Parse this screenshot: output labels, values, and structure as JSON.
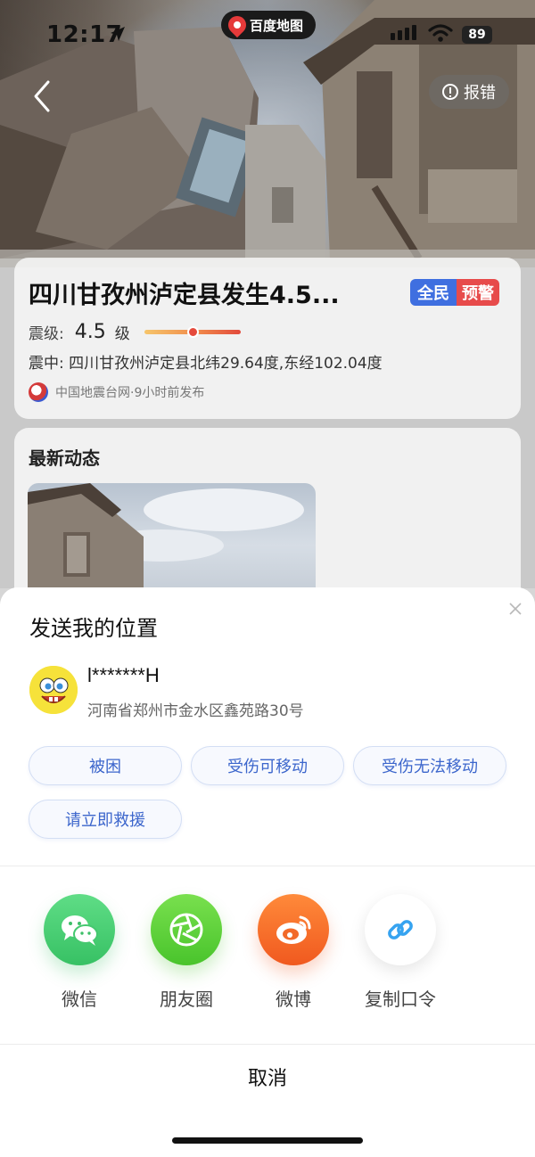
{
  "status_bar": {
    "time": "12:17",
    "app_name": "百度地图",
    "battery": "89"
  },
  "header": {
    "report_label": "报错"
  },
  "event": {
    "title": "四川甘孜州泸定县发生4.5...",
    "badge_left": "全民",
    "badge_right": "预警",
    "magnitude_label": "震级:",
    "magnitude_value": "4.5",
    "magnitude_unit": "级",
    "magnitude_level": 0.5,
    "epicenter": "震中:  四川甘孜州泸定县北纬29.64度,东经102.04度",
    "source": "中国地震台网·9小时前发布"
  },
  "news": {
    "title": "最新动态"
  },
  "sheet": {
    "title": "发送我的位置",
    "user_name": "l*******H",
    "address": "河南省郑州市金水区鑫苑路30号",
    "status_chips": [
      "被困",
      "受伤可移动",
      "受伤无法移动",
      "请立即救援"
    ],
    "share_targets": [
      "微信",
      "朋友圈",
      "微博",
      "复制口令"
    ],
    "cancel_label": "取消"
  },
  "colors": {
    "chip_text": "#3c66cc",
    "badge_blue": "#3f6fe0",
    "badge_red": "#e74b4b",
    "wechat_green": "#37c164",
    "weibo_orange": "#f0591f"
  }
}
